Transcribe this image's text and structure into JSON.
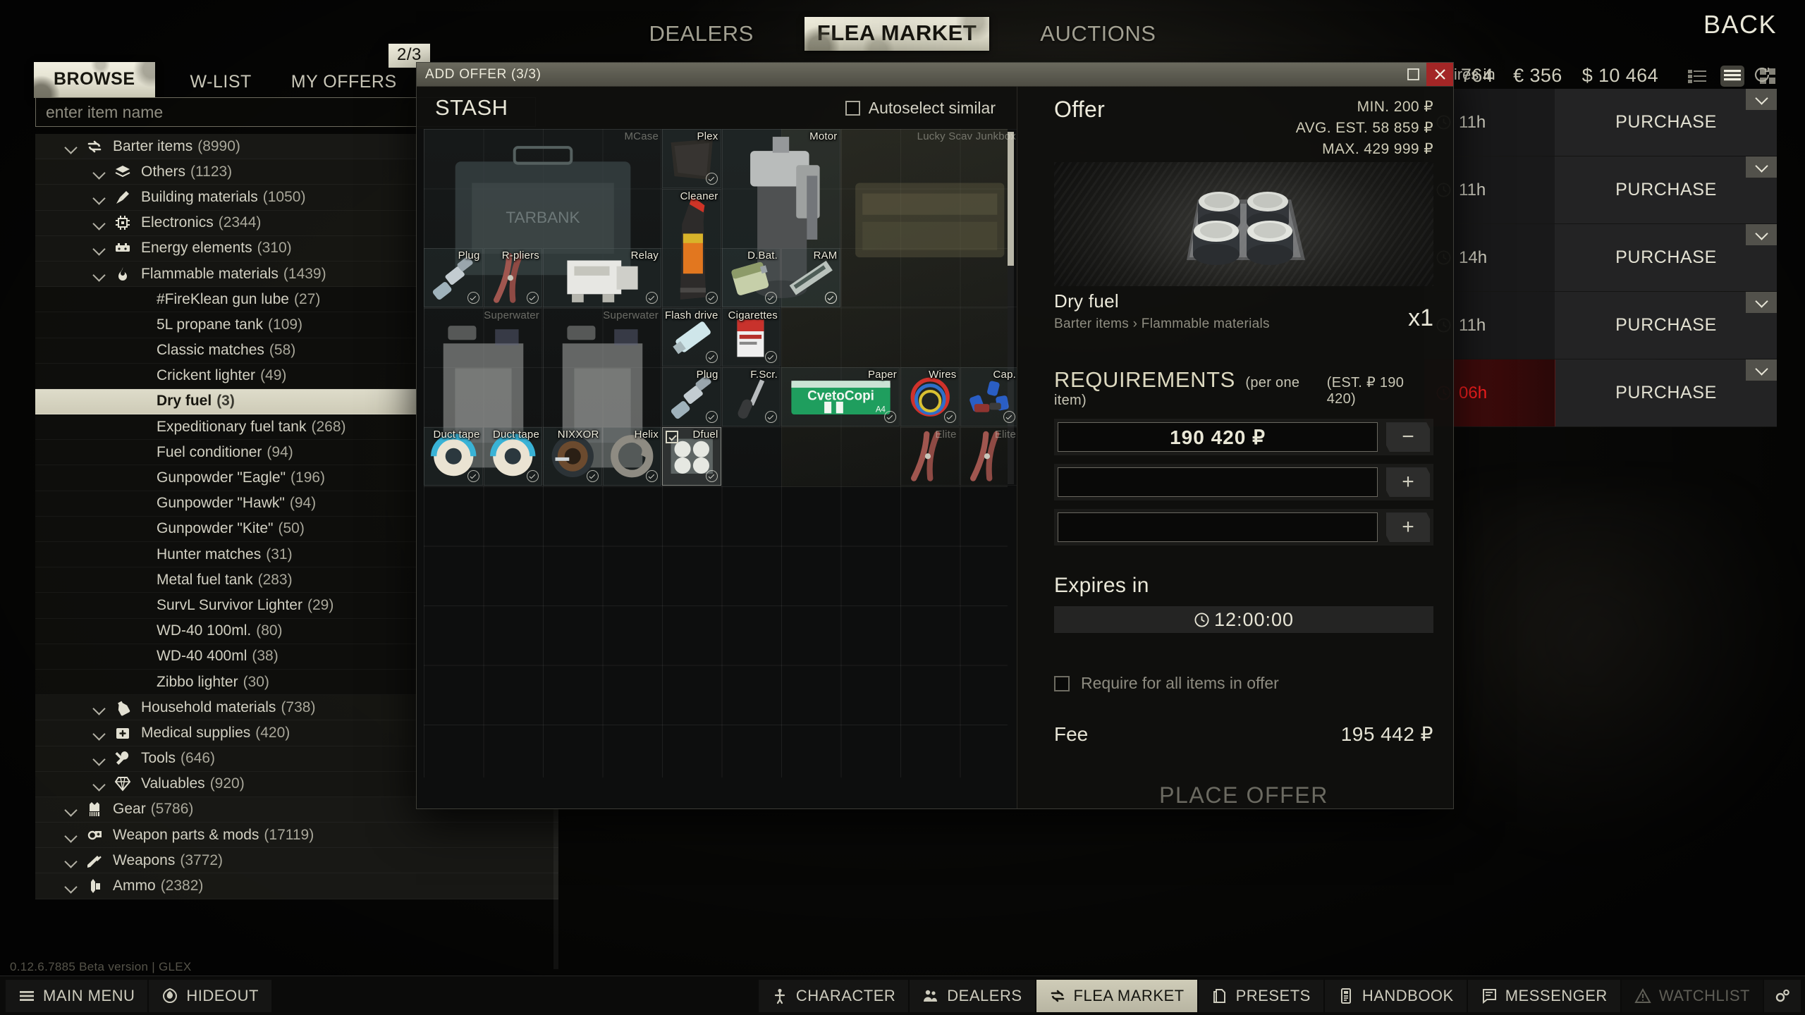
{
  "topnav": {
    "items": [
      {
        "label": "DEALERS",
        "active": false
      },
      {
        "label": "FLEA MARKET",
        "active": true
      },
      {
        "label": "AUCTIONS",
        "active": false
      }
    ],
    "back_label": "BACK"
  },
  "subtabs": {
    "items": [
      {
        "label": "BROWSE",
        "active": true
      },
      {
        "label": "W-LIST",
        "active": false
      },
      {
        "label": "MY OFFERS",
        "active": false
      }
    ],
    "page_badge": "2/3"
  },
  "search": {
    "placeholder": "enter item name"
  },
  "currency": {
    "roubles": "764",
    "euro_symbol": "€",
    "euro": "356",
    "dollar_symbol": "$",
    "dollar": "10 464",
    "view_modes": [
      "compact-list-icon",
      "list-icon",
      "grid-icon"
    ],
    "active_view": "list-icon"
  },
  "tree": {
    "rows": [
      {
        "label": "Barter items",
        "count": "(8990)",
        "level": 0,
        "icon": "barter-icon",
        "expanded": true,
        "selected": false
      },
      {
        "label": "Others",
        "count": "(1123)",
        "level": 1,
        "icon": "layers-icon",
        "expanded": true,
        "selected": false
      },
      {
        "label": "Building materials",
        "count": "(1050)",
        "level": 1,
        "icon": "nail-icon",
        "expanded": true,
        "selected": false
      },
      {
        "label": "Electronics",
        "count": "(2344)",
        "level": 1,
        "icon": "chip-icon",
        "expanded": true,
        "selected": false
      },
      {
        "label": "Energy elements",
        "count": "(310)",
        "level": 1,
        "icon": "battery-icon",
        "expanded": true,
        "selected": false
      },
      {
        "label": "Flammable materials",
        "count": "(1439)",
        "level": 1,
        "icon": "flame-icon",
        "expanded": true,
        "selected": false
      },
      {
        "label": "#FireKlean gun lube",
        "count": "(27)",
        "level": 2,
        "icon": "",
        "expanded": false,
        "selected": false
      },
      {
        "label": "5L propane tank",
        "count": "(109)",
        "level": 2,
        "icon": "",
        "expanded": false,
        "selected": false
      },
      {
        "label": "Classic matches",
        "count": "(58)",
        "level": 2,
        "icon": "",
        "expanded": false,
        "selected": false
      },
      {
        "label": "Crickent lighter",
        "count": "(49)",
        "level": 2,
        "icon": "",
        "expanded": false,
        "selected": false
      },
      {
        "label": "Dry fuel",
        "count": "(3)",
        "level": 2,
        "icon": "",
        "expanded": false,
        "selected": true
      },
      {
        "label": "Expeditionary fuel tank",
        "count": "(268)",
        "level": 2,
        "icon": "",
        "expanded": false,
        "selected": false
      },
      {
        "label": "Fuel conditioner",
        "count": "(94)",
        "level": 2,
        "icon": "",
        "expanded": false,
        "selected": false
      },
      {
        "label": "Gunpowder \"Eagle\"",
        "count": "(196)",
        "level": 2,
        "icon": "",
        "expanded": false,
        "selected": false
      },
      {
        "label": "Gunpowder \"Hawk\"",
        "count": "(94)",
        "level": 2,
        "icon": "",
        "expanded": false,
        "selected": false
      },
      {
        "label": "Gunpowder \"Kite\"",
        "count": "(50)",
        "level": 2,
        "icon": "",
        "expanded": false,
        "selected": false
      },
      {
        "label": "Hunter matches",
        "count": "(31)",
        "level": 2,
        "icon": "",
        "expanded": false,
        "selected": false
      },
      {
        "label": "Metal fuel tank",
        "count": "(283)",
        "level": 2,
        "icon": "",
        "expanded": false,
        "selected": false
      },
      {
        "label": "SurvL Survivor Lighter",
        "count": "(29)",
        "level": 2,
        "icon": "",
        "expanded": false,
        "selected": false
      },
      {
        "label": "WD-40 100ml.",
        "count": "(80)",
        "level": 2,
        "icon": "",
        "expanded": false,
        "selected": false
      },
      {
        "label": "WD-40 400ml",
        "count": "(38)",
        "level": 2,
        "icon": "",
        "expanded": false,
        "selected": false
      },
      {
        "label": "Zibbo lighter",
        "count": "(30)",
        "level": 2,
        "icon": "",
        "expanded": false,
        "selected": false
      },
      {
        "label": "Household materials",
        "count": "(738)",
        "level": 1,
        "icon": "bottle-icon",
        "expanded": true,
        "selected": false
      },
      {
        "label": "Medical supplies",
        "count": "(420)",
        "level": 1,
        "icon": "medkit-icon",
        "expanded": true,
        "selected": false
      },
      {
        "label": "Tools",
        "count": "(646)",
        "level": 1,
        "icon": "tools-icon",
        "expanded": true,
        "selected": false
      },
      {
        "label": "Valuables",
        "count": "(920)",
        "level": 1,
        "icon": "diamond-icon",
        "expanded": true,
        "selected": false
      },
      {
        "label": "Gear",
        "count": "(5786)",
        "level": 0,
        "icon": "vest-icon",
        "expanded": true,
        "selected": false
      },
      {
        "label": "Weapon parts & mods",
        "count": "(17119)",
        "level": 0,
        "icon": "gear-mod-icon",
        "expanded": true,
        "selected": false
      },
      {
        "label": "Weapons",
        "count": "(3772)",
        "level": 0,
        "icon": "rifle-icon",
        "expanded": true,
        "selected": false
      },
      {
        "label": "Ammo",
        "count": "(2382)",
        "level": 0,
        "icon": "ammo-icon",
        "expanded": true,
        "selected": false
      }
    ]
  },
  "version": "0.12.6.7885 Beta version | GLEX",
  "offerlist": {
    "header": "Expires in",
    "refresh_icon": "refresh-icon",
    "rows": [
      {
        "expires": "11h",
        "action": "PURCHASE",
        "expiring": false
      },
      {
        "expires": "11h",
        "action": "PURCHASE",
        "expiring": false
      },
      {
        "expires": "14h",
        "action": "PURCHASE",
        "expiring": false
      },
      {
        "expires": "11h",
        "action": "PURCHASE",
        "expiring": false
      },
      {
        "expires": "06h",
        "action": "PURCHASE",
        "expiring": true
      }
    ]
  },
  "modal": {
    "title": "ADD OFFER (3/3)",
    "restore_icon": "restore-icon",
    "close_icon": "close-icon",
    "stash": {
      "title": "STASH",
      "autoselect_label": "Autoselect similar",
      "autoselect_checked": false,
      "items": [
        {
          "label": "MCase",
          "col": 0,
          "row": 0,
          "w": 4,
          "h": 3,
          "art": "case",
          "faint": true,
          "checked": false,
          "selected": false
        },
        {
          "label": "Plex",
          "col": 4,
          "row": 0,
          "w": 1,
          "h": 1,
          "art": "plexiglass",
          "faint": false,
          "checked": true,
          "selected": false
        },
        {
          "label": "Motor",
          "col": 5,
          "row": 0,
          "w": 2,
          "h": 3,
          "art": "motor",
          "faint": false,
          "checked": true,
          "selected": false
        },
        {
          "label": "Lucky Scav Junkbox",
          "col": 7,
          "row": 0,
          "w": 3,
          "h": 3,
          "art": "junkbox",
          "faint": true,
          "checked": false,
          "selected": false
        },
        {
          "label": "Cleaner",
          "col": 4,
          "row": 1,
          "w": 1,
          "h": 2,
          "art": "cleaner",
          "faint": false,
          "checked": true,
          "selected": false
        },
        {
          "label": "Plug",
          "col": 0,
          "row": 2,
          "w": 1,
          "h": 1,
          "art": "sparkplug",
          "faint": false,
          "checked": true,
          "selected": false
        },
        {
          "label": "R-pliers",
          "col": 1,
          "row": 2,
          "w": 1,
          "h": 1,
          "art": "pliers",
          "faint": false,
          "checked": true,
          "selected": false
        },
        {
          "label": "Relay",
          "col": 2,
          "row": 2,
          "w": 2,
          "h": 1,
          "art": "relay",
          "faint": false,
          "checked": true,
          "selected": false
        },
        {
          "label": "D.Bat.",
          "col": 5,
          "row": 2,
          "w": 1,
          "h": 1,
          "art": "battery",
          "faint": false,
          "checked": true,
          "selected": false
        },
        {
          "label": "RAM",
          "col": 6,
          "row": 2,
          "w": 1,
          "h": 1,
          "art": "ram",
          "faint": false,
          "checked": true,
          "selected": false
        },
        {
          "label": "Superwater",
          "col": 0,
          "row": 3,
          "w": 2,
          "h": 3,
          "art": "jerrycan",
          "faint": true,
          "checked": false,
          "selected": false
        },
        {
          "label": "Superwater",
          "col": 2,
          "row": 3,
          "w": 2,
          "h": 3,
          "art": "jerrycan",
          "faint": true,
          "checked": false,
          "selected": false
        },
        {
          "label": "Flash drive",
          "col": 4,
          "row": 3,
          "w": 1,
          "h": 1,
          "art": "flashdrive",
          "faint": false,
          "checked": true,
          "selected": false
        },
        {
          "label": "Cigarettes",
          "col": 5,
          "row": 3,
          "w": 1,
          "h": 1,
          "art": "cigarettes",
          "faint": false,
          "checked": true,
          "selected": false
        },
        {
          "label": "Plug",
          "col": 4,
          "row": 4,
          "w": 1,
          "h": 1,
          "art": "sparkplug",
          "faint": false,
          "checked": true,
          "selected": false
        },
        {
          "label": "F.Scr.",
          "col": 5,
          "row": 4,
          "w": 1,
          "h": 1,
          "art": "screwdriver",
          "faint": false,
          "checked": true,
          "selected": false
        },
        {
          "label": "Paper",
          "col": 6,
          "row": 4,
          "w": 2,
          "h": 1,
          "art": "paper",
          "faint": false,
          "checked": true,
          "selected": false
        },
        {
          "label": "Wires",
          "col": 8,
          "row": 4,
          "w": 1,
          "h": 1,
          "art": "wires",
          "faint": false,
          "checked": true,
          "selected": false
        },
        {
          "label": "Cap.",
          "col": 9,
          "row": 4,
          "w": 1,
          "h": 1,
          "art": "capacitors",
          "faint": false,
          "checked": true,
          "selected": false
        },
        {
          "label": "Duct tape",
          "col": 0,
          "row": 5,
          "w": 1,
          "h": 1,
          "art": "ducttape",
          "faint": false,
          "checked": true,
          "selected": false
        },
        {
          "label": "Duct tape",
          "col": 1,
          "row": 5,
          "w": 1,
          "h": 1,
          "art": "ducttape",
          "faint": false,
          "checked": true,
          "selected": false
        },
        {
          "label": "NIXXOR",
          "col": 2,
          "row": 5,
          "w": 1,
          "h": 1,
          "art": "lens",
          "faint": false,
          "checked": true,
          "selected": false
        },
        {
          "label": "Helix",
          "col": 3,
          "row": 5,
          "w": 1,
          "h": 1,
          "art": "cable",
          "faint": false,
          "checked": true,
          "selected": false
        },
        {
          "label": "Dfuel",
          "col": 4,
          "row": 5,
          "w": 1,
          "h": 1,
          "art": "dryfuel",
          "faint": false,
          "checked": true,
          "selected": true
        },
        {
          "label": "Elite",
          "col": 8,
          "row": 5,
          "w": 1,
          "h": 1,
          "art": "pliers",
          "faint": true,
          "checked": false,
          "selected": false
        },
        {
          "label": "Elite",
          "col": 9,
          "row": 5,
          "w": 1,
          "h": 1,
          "art": "pliers",
          "faint": true,
          "checked": false,
          "selected": false
        }
      ]
    },
    "offer": {
      "heading": "Offer",
      "min_label": "MIN. 200 ₽",
      "avg_label": "AVG. EST. 58 859 ₽",
      "max_label": "MAX. 429 999 ₽",
      "item_name": "Dry fuel",
      "item_path": "Barter items › Flammable materials",
      "item_qty": "x1",
      "requirements_title": "REQUIREMENTS",
      "requirements_sub": "(per one item)",
      "requirements_est": "(EST. ₽ 190 420)",
      "req_rows": [
        {
          "value": "190 420 ₽",
          "button": "−",
          "button_name": "minus"
        },
        {
          "value": "",
          "button": "+",
          "button_name": "plus"
        },
        {
          "value": "",
          "button": "+",
          "button_name": "plus"
        }
      ],
      "expires_label": "Expires in",
      "expires_value": "12:00:00",
      "expires_icon": "clock-icon",
      "require_all_label": "Require for all items in offer",
      "require_all_checked": false,
      "fee_label": "Fee",
      "fee_value": "195 442 ₽",
      "place_offer_label": "PLACE OFFER"
    }
  },
  "taskbar": {
    "left": [
      {
        "label": "MAIN MENU",
        "icon": "hamburger-icon",
        "active": false,
        "dim": false
      },
      {
        "label": "HIDEOUT",
        "icon": "hideout-icon",
        "active": false,
        "dim": false
      }
    ],
    "right": [
      {
        "label": "CHARACTER",
        "icon": "character-icon",
        "active": false,
        "dim": false
      },
      {
        "label": "DEALERS",
        "icon": "dealers-icon",
        "active": false,
        "dim": false
      },
      {
        "label": "FLEA MARKET",
        "icon": "flea-icon",
        "active": true,
        "dim": false
      },
      {
        "label": "PRESETS",
        "icon": "presets-icon",
        "active": false,
        "dim": false
      },
      {
        "label": "HANDBOOK",
        "icon": "handbook-icon",
        "active": false,
        "dim": false
      },
      {
        "label": "MESSENGER",
        "icon": "messenger-icon",
        "active": false,
        "dim": false
      },
      {
        "label": "WATCHLIST",
        "icon": "watchlist-icon",
        "active": false,
        "dim": true
      },
      {
        "label": "",
        "icon": "settings-gear-icon",
        "active": false,
        "dim": false
      }
    ]
  }
}
